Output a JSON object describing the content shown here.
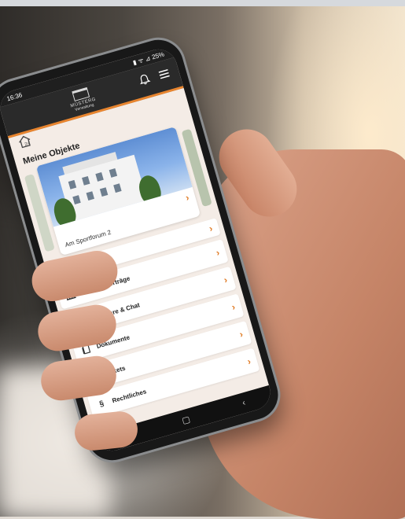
{
  "status_bar": {
    "time": "16:36",
    "indicators": "▮ ᯤ ⊿ 25%"
  },
  "header": {
    "logo_name": "MÜSTERG",
    "logo_sub": "Verwaltung",
    "bell_icon": "bell-icon",
    "menu_icon": "hamburger-menu-icon"
  },
  "subheader": {
    "home_icon": "house-24-icon",
    "badge": "24"
  },
  "objects": {
    "title": "Meine Objekte",
    "cards": [
      {
        "label": "Am Sportforum 2",
        "chevron": "›"
      }
    ]
  },
  "menu": {
    "items": [
      {
        "label": "",
        "icon": "",
        "chevron": "›"
      },
      {
        "label": "Alle Mietverträge",
        "icon": "bar-chart-icon",
        "chevron": "›"
      },
      {
        "label": "Formulare & Chat",
        "icon": "chat-bubble-icon",
        "chevron": "›"
      },
      {
        "label": "Dokumente",
        "icon": "document-icon",
        "chevron": "›"
      },
      {
        "label": "Tickets",
        "icon": "ticket-icon",
        "chevron": "›"
      },
      {
        "label": "Rechtliches",
        "icon": "paragraph-icon",
        "chevron": "›"
      }
    ]
  },
  "nav": {
    "recent": "|||",
    "home": "▢",
    "back": "‹"
  },
  "colors": {
    "accent": "#e07a23",
    "header": "#2a2a2a",
    "screen_bg": "#f4ece6"
  }
}
